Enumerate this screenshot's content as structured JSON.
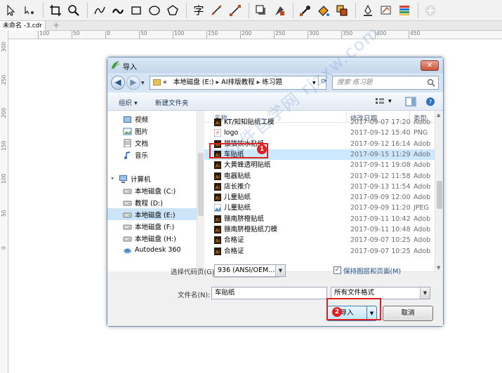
{
  "app": {
    "doc_tab": "未命名 -3.cdr",
    "tab_add": "+"
  },
  "toolbar": {
    "tools": [
      "pick-tool",
      "shape-tool",
      "crop-tool",
      "zoom-tool",
      "freehand-tool",
      "artistic-media-tool",
      "rectangle-tool",
      "ellipse-tool",
      "polygon-tool",
      "text-tool",
      "dimension-tool",
      "connector-tool",
      "drop-shadow-tool",
      "transparency-tool",
      "color-eyedropper-tool",
      "interactive-fill-tool",
      "smart-fill-tool",
      "outline-pen-tool",
      "edit-fill-tool",
      "color-palette-tool",
      "add-tool"
    ]
  },
  "ruler": {
    "h_ticks": [
      "100",
      "50",
      "0",
      "50",
      "100",
      "150",
      "200",
      "250",
      "300",
      "350",
      "400",
      "450"
    ],
    "v_ticks": [
      "300",
      "250",
      "200",
      "150",
      "100",
      "50",
      "0"
    ]
  },
  "dialog": {
    "title": "导入",
    "close_label": "✕",
    "address": [
      "本地磁盘 (E:)",
      "AI排版教程",
      "练习题"
    ],
    "address_prefix": "«",
    "search_placeholder": "搜索 练习题",
    "organize_label": "组织 ▾",
    "new_folder_label": "新建文件夹",
    "nav": [
      {
        "label": "视频",
        "icon": "video-icon"
      },
      {
        "label": "图片",
        "icon": "picture-icon"
      },
      {
        "label": "文档",
        "icon": "document-icon"
      },
      {
        "label": "音乐",
        "icon": "music-icon"
      },
      {
        "label": "计算机",
        "icon": "computer-icon"
      },
      {
        "label": "本地磁盘 (C:)",
        "icon": "drive-icon"
      },
      {
        "label": "教程 (D:)",
        "icon": "drive-icon"
      },
      {
        "label": "本地磁盘 (E:)",
        "icon": "drive-icon"
      },
      {
        "label": "本地磁盘 (F:)",
        "icon": "drive-icon"
      },
      {
        "label": "本地磁盘 (H:)",
        "icon": "drive-icon"
      },
      {
        "label": "Autodesk 360",
        "icon": "cloud-icon"
      }
    ],
    "columns": {
      "name": "名称",
      "date": "修改日期",
      "type": "类型"
    },
    "files": [
      {
        "name": "KT/知知贴纸工模",
        "date": "2017-09-07 17:20",
        "type": "Adob"
      },
      {
        "name": "logo",
        "date": "2017-09-12 15:40",
        "type": "PNG"
      },
      {
        "name": "猫猫饮水贴纸",
        "date": "2017-09-12 16:14",
        "type": "Adob"
      },
      {
        "name": "车贴纸",
        "date": "2017-09-15 11:29",
        "type": "Adob"
      },
      {
        "name": "大黄蜂透明贴纸",
        "date": "2017-09-11 19:08",
        "type": "Adob"
      },
      {
        "name": "电器贴纸",
        "date": "2017-09-12 11:58",
        "type": "Adob"
      },
      {
        "name": "店长推介",
        "date": "2017-09-13 11:54",
        "type": "Adob"
      },
      {
        "name": "儿童贴纸",
        "date": "2017-09-09 12:00",
        "type": "Adob"
      },
      {
        "name": "儿童贴纸",
        "date": "2017-09-09 11:20",
        "type": "JPEG"
      },
      {
        "name": "赣南脐橙贴纸",
        "date": "2017-09-11 10:42",
        "type": "Adob"
      },
      {
        "name": "赣南脐橙贴纸刀模",
        "date": "2017-09-11 10:48",
        "type": "Adob"
      },
      {
        "name": "合格证",
        "date": "2017-09-07 10:25",
        "type": "Adob"
      },
      {
        "name": "合格证",
        "date": "2017-09-07 10:25",
        "type": "Adob"
      }
    ],
    "codepage_label": "选择代码页(G)",
    "codepage_value": "936  (ANSI/OEM...",
    "keep_layers_label": "保持图层和页面(M)",
    "keep_layers_checked": "✓",
    "filename_label": "文件名(N):",
    "filename_value": "车贴纸",
    "filetype_value": "所有文件格式",
    "import_label": "导入",
    "cancel_label": "取消",
    "badge1": "1",
    "badge2": "2"
  },
  "watermark": "软件自学网 rjzxw.com",
  "colors": {
    "highlight": "#e02020",
    "selection": "#cce8ff",
    "accent": "#3c7fb1"
  }
}
